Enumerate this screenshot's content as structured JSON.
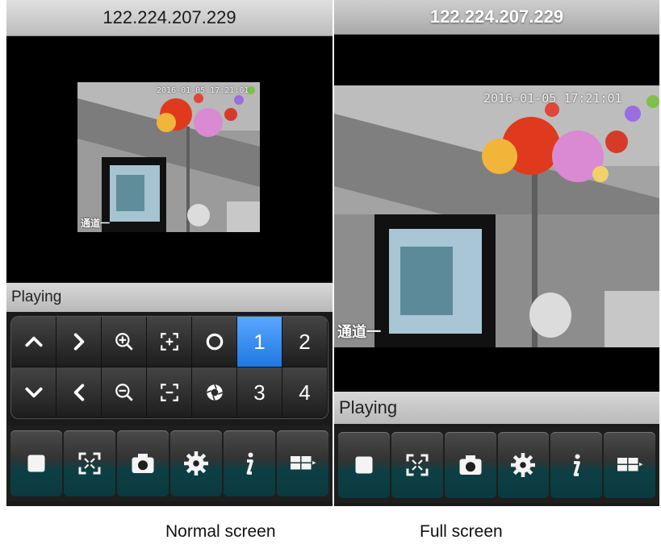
{
  "screens": [
    {
      "ip": "122.224.207.229",
      "status": "Playing",
      "caption": "Normal screen",
      "timestamp": "2016-01-05 17:21:01",
      "channel_label": "通道一"
    },
    {
      "ip": "122.224.207.229",
      "status": "Playing",
      "caption": "Full screen",
      "timestamp": "2016-01-05 17:21:01",
      "channel_label": "通道一"
    }
  ],
  "ptz": {
    "row1": [
      "up-arrow-icon",
      "right-arrow-icon",
      "zoom-in-icon",
      "focus-plus-icon",
      "iris-ring-icon",
      "1",
      "2"
    ],
    "row2": [
      "down-arrow-icon",
      "left-arrow-icon",
      "zoom-out-icon",
      "focus-minus-icon",
      "aperture-icon",
      "3",
      "4"
    ],
    "active_channel": "1"
  },
  "toolbar": [
    "stop-icon",
    "fullscreen-icon",
    "camera-icon",
    "gear-icon",
    "info-icon",
    "grid-layout-icon"
  ],
  "colors": {
    "accent": "#2a82ee",
    "toolbar_teal": "#0a3a3f",
    "status_bg": "#c8c8c8"
  }
}
